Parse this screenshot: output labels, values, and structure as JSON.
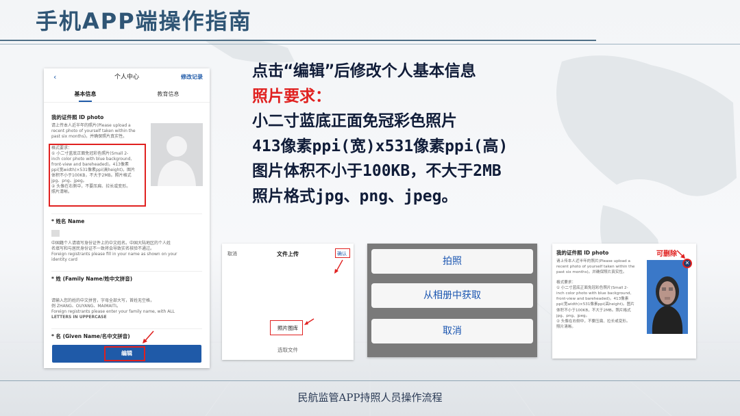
{
  "slide": {
    "title": "手机APP端操作指南",
    "footer": "民航监管APP持照人员操作流程"
  },
  "instructions": {
    "line1": "点击“编辑”后修改个人基本信息",
    "line2": "照片要求：",
    "line3": "小二寸蓝底正面免冠彩色照片",
    "line4": "413像素ppi(宽)x531像素ppi(高)",
    "line5": "图片体积不小于100KB，不大于2MB",
    "line6": "照片格式jpg、png、jpeg。"
  },
  "profile_screen": {
    "back_icon": "chevron-left-icon",
    "header_title": "个人中心",
    "edit_history": "修改记录",
    "tabs": [
      "基本信息",
      "教育信息"
    ],
    "id_photo_title": "我的证件照 ID photo",
    "id_photo_desc_lines": [
      "请上传本人近半年的照片(Please upload a",
      "recent photo of yourself taken within the",
      "past six months)。并确保照片真实性。"
    ],
    "requirements_lines": [
      "格式要求：",
      "① 小二寸蓝底正面免冠彩色照片(Small 2-",
      "inch color photo with blue background,",
      "front-view and bareheaded)。413像素",
      "ppi(宽width)×531像素ppi(高height)。图片",
      "体积不小于100KB，不大于2MB。照片格式",
      "jpg、png、jpeg。",
      "② 头像在右侧中，不要压扁、拉长或变形。",
      "照片清晰。"
    ],
    "name_label": "* 姓名 Name",
    "name_desc_lines": [
      "中国籍个人请填写身份证件上的中文姓名。中国大陆地区的个人姓",
      "名填写和与居民身份证不一致将会导致实名核验不通过。",
      "Foreign registrants please fill in your name as shown on your",
      "identity card"
    ],
    "family_name_label": "* 姓 (Family Name/姓中文拼音)",
    "family_name_desc_lines": [
      "请输入您的姓的中文拼音，字母全部大写，首姓无空格，",
      "例 ZHANG、OUYANG、MAIMAITI。",
      "Foreign registrants please enter your family name, with ALL",
      "LETTERS IN UPPERCASE"
    ],
    "given_name_label": "* 名 (Given Name/名中文拼音)",
    "edit_button": "编辑"
  },
  "upload_screen": {
    "cancel": "取消",
    "title": "文件上传",
    "confirm": "确认",
    "photo_library": "照片图库",
    "choose_file": "选取文件"
  },
  "action_sheet": {
    "take_photo": "拍照",
    "from_album": "从相册中获取",
    "cancel": "取消"
  },
  "photo_preview": {
    "id_photo_title": "我的证件照 ID photo",
    "deletable_label": "可删除",
    "close_icon": "close-icon",
    "desc_lines": [
      "请上传本人近半年的照片(Please upload a",
      "recent photo of yourself taken within the",
      "past six months)。并确保照片真实性。",
      "",
      "格式要求：",
      "① 小二寸蓝底正面免冠彩色照片(Small 2-",
      "inch color photo with blue background,",
      "front-view and bareheaded)。413像素",
      "ppi(宽width)×531像素ppi(高height)。图片",
      "体积不小于100KB，不大于2MB。照片格式",
      "jpg、png、jpeg。",
      "② 头像在右侧中，不要压扁、拉长或变形。",
      "照片清晰。"
    ]
  },
  "colors": {
    "title": "#2f5575",
    "highlight_red": "#e0201f",
    "primary_blue": "#1f5aa8"
  }
}
